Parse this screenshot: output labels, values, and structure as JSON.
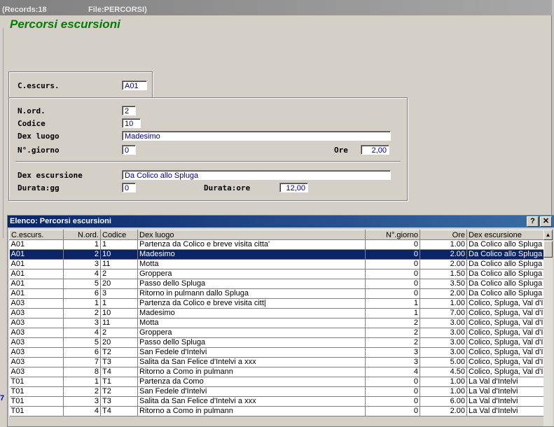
{
  "titlebar": {
    "records": "(Records:18",
    "file": "File:PERCORSI)"
  },
  "form": {
    "title": "Percorsi escursioni",
    "c_escurs": {
      "label": "C.escurs.",
      "value": "A01"
    },
    "n_ord": {
      "label": "N.ord.",
      "value": "2"
    },
    "codice": {
      "label": "Codice",
      "value": "10"
    },
    "dex_luogo": {
      "label": "Dex luogo",
      "value": "Madesimo"
    },
    "n_giorno": {
      "label": "N°.giorno",
      "value": "0"
    },
    "ore": {
      "label": "Ore",
      "value": "2,00"
    },
    "dex_escursione": {
      "label": "Dex escursione",
      "value": "Da Colico allo Spluga"
    },
    "durata_gg": {
      "label": "Durata:gg",
      "value": "0"
    },
    "durata_ore": {
      "label": "Durata:ore",
      "value": "12,00"
    }
  },
  "grid": {
    "title": "Elenco: Percorsi escursioni",
    "help_btn": "?",
    "close_btn": "✕",
    "columns": [
      "C.escurs.",
      "N.ord.",
      "Codice",
      "Dex luogo",
      "N°.giorno",
      "Ore",
      "Dex escursione"
    ],
    "rows": [
      [
        "A01",
        "1",
        "1",
        "Partenza da Colico e breve visita citta'",
        "0",
        "1.00",
        "Da Colico allo Spluga"
      ],
      [
        "A01",
        "2",
        "10",
        "Madesimo",
        "0",
        "2.00",
        "Da Colico allo Spluga"
      ],
      [
        "A01",
        "3",
        "11",
        "Motta",
        "0",
        "2.00",
        "Da Colico allo Spluga"
      ],
      [
        "A01",
        "4",
        "2",
        "Groppera",
        "0",
        "1.50",
        "Da Colico allo Spluga"
      ],
      [
        "A01",
        "5",
        "20",
        "Passo dello Spluga",
        "0",
        "3.50",
        "Da Colico allo Spluga"
      ],
      [
        "A01",
        "6",
        "3",
        "Ritorno in pulmann dallo Spluga",
        "0",
        "2.00",
        "Da Colico allo Spluga"
      ],
      [
        "A03",
        "1",
        "1",
        "Partenza da Colico e breve visita citt|",
        "1",
        "1.00",
        "Colico, Spluga, Val d'Ir"
      ],
      [
        "A03",
        "2",
        "10",
        "Madesimo",
        "1",
        "7.00",
        "Colico, Spluga, Val d'Ir"
      ],
      [
        "A03",
        "3",
        "11",
        "Motta",
        "2",
        "3.00",
        "Colico, Spluga, Val d'Ir"
      ],
      [
        "A03",
        "4",
        "2",
        "Groppera",
        "2",
        "3.00",
        "Colico, Spluga, Val d'Ir"
      ],
      [
        "A03",
        "5",
        "20",
        "Passo dello Spluga",
        "2",
        "3.00",
        "Colico, Spluga, Val d'Ir"
      ],
      [
        "A03",
        "6",
        "T2",
        "San Fedele d'Intelvi",
        "3",
        "3.00",
        "Colico, Spluga, Val d'Ir"
      ],
      [
        "A03",
        "7",
        "T3",
        "Salita da San Felice d'Intelvi a xxx",
        "3",
        "5.00",
        "Colico, Spluga, Val d'Ir"
      ],
      [
        "A03",
        "8",
        "T4",
        "Ritorno a Como in pulmann",
        "4",
        "4.50",
        "Colico, Spluga, Val d'Ir"
      ],
      [
        "T01",
        "1",
        "T1",
        "Partenza da Como",
        "0",
        "1.00",
        "La Val d'Intelvi"
      ],
      [
        "T01",
        "2",
        "T2",
        "San Fedele d'Intelvi",
        "0",
        "1.00",
        "La Val d'Intelvi"
      ],
      [
        "T01",
        "3",
        "T3",
        "Salita da San Felice d'Intelvi a xxx",
        "0",
        "6.00",
        "La Val d'Intelvi"
      ],
      [
        "T01",
        "4",
        "T4",
        "Ritorno a Como in pulmann",
        "0",
        "2.00",
        "La Val d'Intelvi"
      ]
    ],
    "selected_row": 1
  },
  "side_mark": "7",
  "colors": {
    "accent_title": "#008000",
    "selection": "#0a246a",
    "input_text": "#000080"
  }
}
